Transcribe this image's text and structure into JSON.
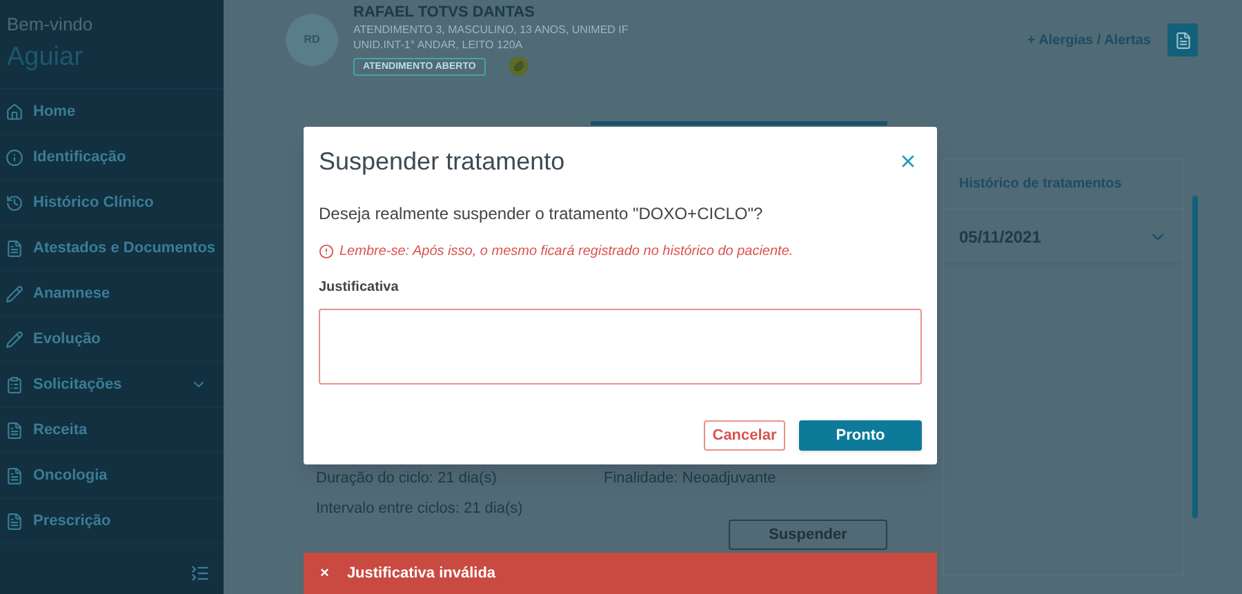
{
  "sidebar": {
    "greeting": "Bem-vindo",
    "user": "Aguiar",
    "items": [
      {
        "label": "Home",
        "expandable": false
      },
      {
        "label": "Identificação",
        "expandable": false
      },
      {
        "label": "Histórico Clínico",
        "expandable": false
      },
      {
        "label": "Atestados e Documentos",
        "expandable": false
      },
      {
        "label": "Anamnese",
        "expandable": false
      },
      {
        "label": "Evolução",
        "expandable": false
      },
      {
        "label": "Solicitações",
        "expandable": true
      },
      {
        "label": "Receita",
        "expandable": false
      },
      {
        "label": "Oncologia",
        "expandable": false
      },
      {
        "label": "Prescrição",
        "expandable": false
      }
    ]
  },
  "patient": {
    "initials": "RD",
    "name": "RAFAEL TOTVS DANTAS",
    "line_1": "ATENDIMENTO 3, MASCULINO, 13 ANOS, UNIMED IF",
    "line_2": "UNID.INT-1° ANDAR, LEITO 120A",
    "status": "ATENDIMENTO ABERTO"
  },
  "header_actions": {
    "alerts": "+ Alergias / Alertas"
  },
  "background": {
    "details": [
      {
        "label": "Duração do ciclo:",
        "value": "21 dia(s)"
      },
      {
        "label": "Finalidade:",
        "value": "Neoadjuvante"
      },
      {
        "label": "Intervalo entre ciclos:",
        "value": "21 dia(s)"
      }
    ],
    "suspend_button": "Suspender",
    "history": {
      "title": "Histórico de tratamentos",
      "items": [
        {
          "date": "05/11/2021",
          "expanded": false
        }
      ]
    }
  },
  "dialog": {
    "title": "Suspender tratamento",
    "question": "Deseja realmente suspender o tratamento \"DOXO+CICLO\"?",
    "warning": "Lembre-se: Após isso, o mesmo ficará registrado no histórico do paciente.",
    "field_label": "Justificativa",
    "field_invalid": true,
    "buttons": [
      {
        "label": "Cancelar",
        "kind": "secondary"
      },
      {
        "label": "Pronto",
        "kind": "primary"
      }
    ]
  },
  "toast": {
    "icon": "×",
    "message": "Justificativa inválida"
  }
}
